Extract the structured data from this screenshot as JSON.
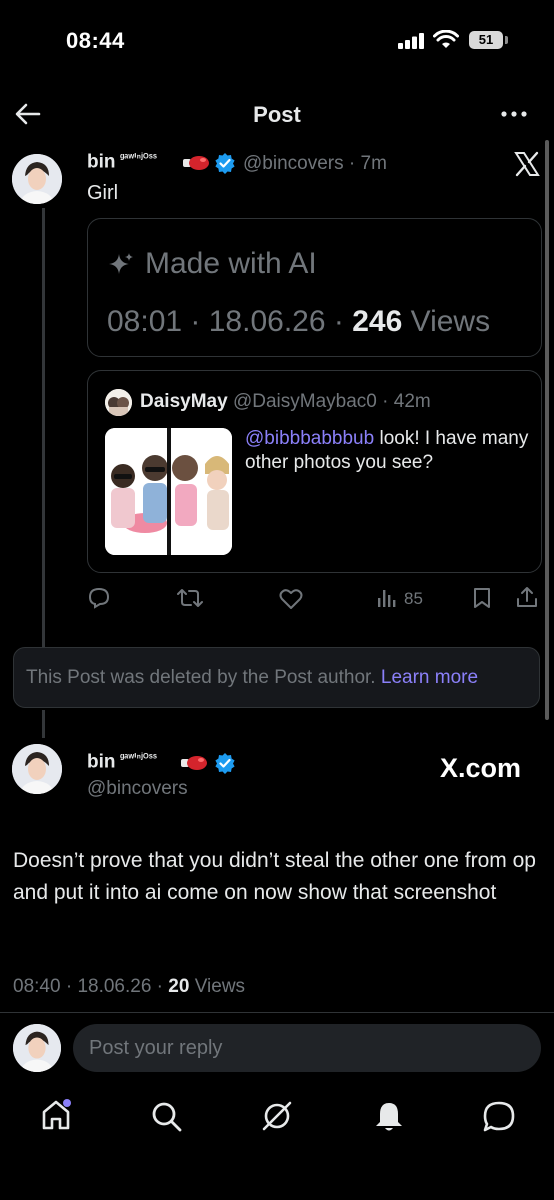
{
  "status_bar": {
    "time": "08:44",
    "battery": "51"
  },
  "header": {
    "title": "Post"
  },
  "main_post": {
    "name": "bin",
    "name_suffix": "ᵍᵃʷⁱⁿʲᴼˢˢ",
    "handle": "@bincovers",
    "time": "7m",
    "text": "Girl",
    "ai_card": {
      "label": "Made with AI",
      "time": "08:01",
      "date": "18.06.26",
      "views_count": "246",
      "views_label": "Views"
    },
    "quote": {
      "name": "DaisyMay",
      "handle": "@DaisyMaybac0",
      "time": "42m",
      "mention": "@bibbbabbbub",
      "text": " look! I have many other photos you see?"
    },
    "actions": {
      "views": "85"
    }
  },
  "deleted_notice": {
    "text": "This Post was deleted by the Post author.",
    "link": "Learn more"
  },
  "second_post": {
    "name": "bin",
    "name_suffix": "ᵍᵃʷⁱⁿʲᴼˢˢ",
    "handle": "@bincovers",
    "watermark": "X.com",
    "text": "Doesn’t prove that you didn’t steal the other one from op and put it into ai come on now show that screenshot",
    "time": "08:40",
    "date": "18.06.26",
    "views_count": "20",
    "views_label": "Views"
  },
  "reply": {
    "placeholder": "Post your reply"
  },
  "colors": {
    "accent": "#1d9bf0",
    "link": "#8b80f9",
    "muted": "#71767b",
    "border": "#2f3336"
  },
  "nav_icons": [
    "home-icon",
    "search-icon",
    "grok-icon",
    "notifications-icon",
    "messages-icon"
  ]
}
